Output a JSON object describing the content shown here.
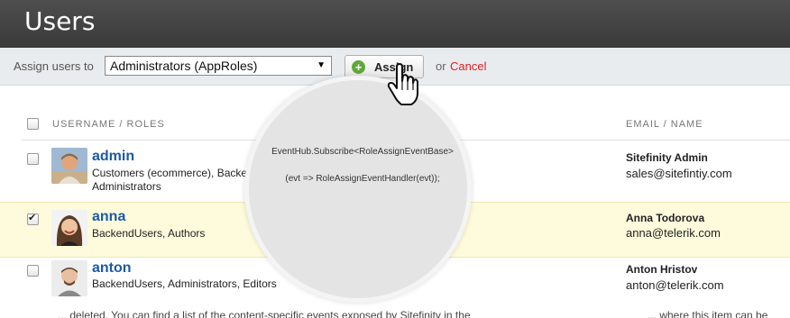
{
  "header": {
    "title": "Users"
  },
  "toolbar": {
    "assign_label": "Assign users to",
    "role_select_value": "Administrators (AppRoles)",
    "assign_button": "Assign",
    "or_text": "or",
    "cancel_link": "Cancel"
  },
  "table": {
    "columns": {
      "username_roles": "USERNAME / ROLES",
      "email_name": "EMAIL / NAME"
    },
    "rows": [
      {
        "username": "admin",
        "roles": "Customers (ecommerce), Backe... Administrators",
        "roles_line1": "Customers (ecommerce), Backe",
        "roles_line2": "Administrators",
        "full_name": "Sitefinity Admin",
        "email": "sales@sitefintiy.com",
        "checked": false
      },
      {
        "username": "anna",
        "roles": "BackendUsers, Authors",
        "full_name": "Anna Todorova",
        "email": "anna@telerik.com",
        "checked": true
      },
      {
        "username": "anton",
        "roles": "BackendUsers, Administrators, Editors",
        "full_name": "Anton Hristov",
        "email": "anton@telerik.com",
        "checked": false
      }
    ]
  },
  "overlay": {
    "code_line1": "EventHub.Subscribe<RoleAssignEventBase>",
    "code_line2": "(evt => RoleAssignEventHandler(evt));"
  },
  "bottom": {
    "text": "... deleted. You can find a list of the content-specific events exposed by Sitefinity in the",
    "text_right": "... where this item can be found"
  },
  "colors": {
    "accent": "#1b5aa5",
    "cancel": "#e02020",
    "selected_row": "#fdfbdc",
    "header_bg": "#444444"
  }
}
